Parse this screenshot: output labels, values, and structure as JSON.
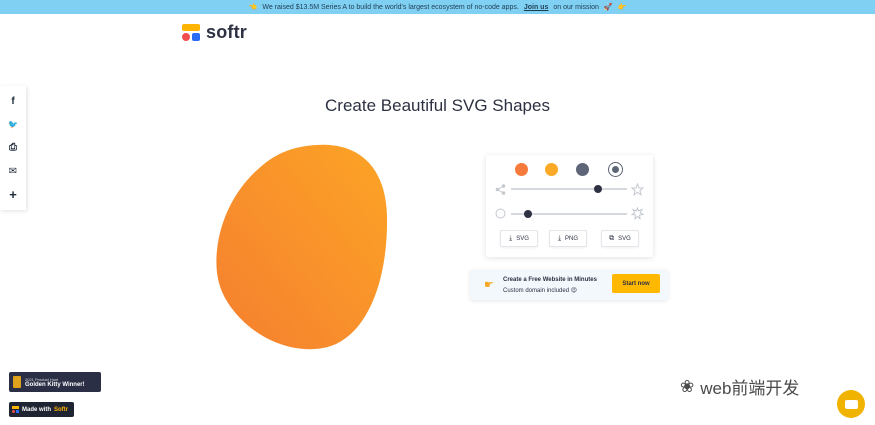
{
  "banner": {
    "left_emoji": "👈",
    "text_before": "We raised $13.5M Series A to build the world's largest ecosystem of no-code apps.",
    "link": "Join us",
    "text_after": "on our mission",
    "after_emoji": "🚀",
    "right_emoji": "👉"
  },
  "brand": {
    "name": "softr",
    "colors": {
      "yellow": "#ffb400",
      "red": "#f24e4e",
      "blue": "#2a6cf6"
    }
  },
  "share_bar": {
    "items": [
      {
        "icon": "facebook-icon",
        "glyph": "f"
      },
      {
        "icon": "twitter-icon",
        "glyph": "🐦"
      },
      {
        "icon": "print-icon",
        "glyph": "⎙"
      },
      {
        "icon": "email-icon",
        "glyph": "✉"
      },
      {
        "icon": "plus-icon",
        "glyph": "+"
      }
    ]
  },
  "page": {
    "title": "Create Beautiful SVG Shapes"
  },
  "shape": {
    "color_start": "#f57f30",
    "color_end": "#fca425"
  },
  "controls": {
    "colors": [
      {
        "name": "orange",
        "hex": "#f57a3c"
      },
      {
        "name": "amber",
        "hex": "#fbaa27"
      },
      {
        "name": "slate",
        "hex": "#5d6577"
      }
    ],
    "random_icon": "gradient-toggle-icon",
    "complexity_slider": {
      "value": 0.75
    },
    "contrast_slider": {
      "value": 0.15
    },
    "buttons": [
      {
        "label": "SVG",
        "icon": "download-icon"
      },
      {
        "label": "PNG",
        "icon": "download-icon"
      },
      {
        "label": "SVG",
        "icon": "copy-icon"
      }
    ]
  },
  "promo": {
    "title": "Create a Free Website in Minutes",
    "subtitle": "Custom domain included",
    "subtitle_emoji": "😍",
    "cta": "Start now"
  },
  "badges": {
    "kitty_small": "2021 Product Hunt",
    "kitty_big": "Golden Kitty Winner!",
    "made_with_prefix": "Made with",
    "made_with_brand": "Softr"
  },
  "watermark": {
    "text": "web前端开发"
  }
}
